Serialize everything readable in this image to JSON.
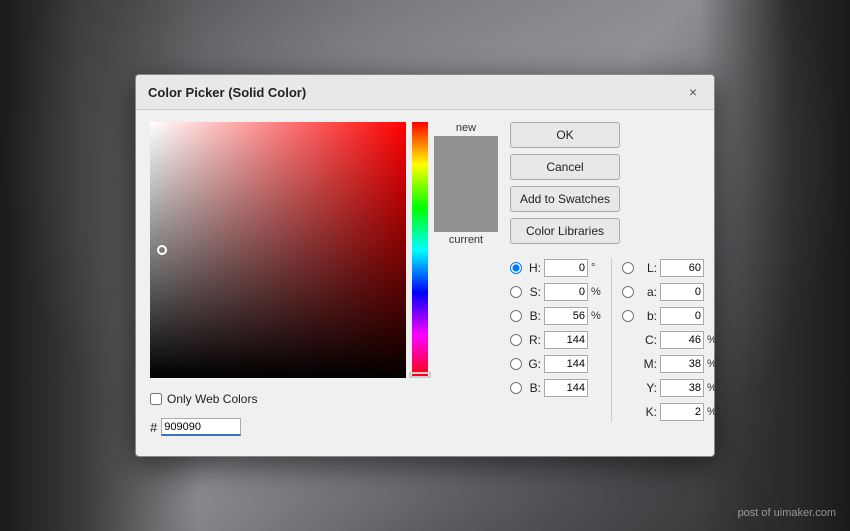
{
  "background": {
    "watermark": "post of uimaker.com"
  },
  "dialog": {
    "title": "Color Picker (Solid Color)",
    "close_icon": "×",
    "buttons": {
      "ok": "OK",
      "cancel": "Cancel",
      "add_to_swatches": "Add to Swatches",
      "color_libraries": "Color Libraries"
    },
    "preview": {
      "new_label": "new",
      "current_label": "current",
      "new_color": "#909090",
      "current_color": "#909090"
    },
    "fields": {
      "H_checked": true,
      "H_value": "0",
      "H_unit": "°",
      "S_value": "0",
      "S_unit": "%",
      "B_value": "56",
      "B_unit": "%",
      "R_value": "144",
      "G_value": "144",
      "B2_value": "144",
      "L_value": "60",
      "a_value": "0",
      "b_value": "0",
      "C_value": "46",
      "C_unit": "%",
      "M_value": "38",
      "M_unit": "%",
      "Y_value": "38",
      "Y_unit": "%",
      "K_value": "2",
      "K_unit": "%",
      "hex_value": "909090"
    },
    "only_web_colors": {
      "checked": false,
      "label": "Only Web Colors"
    }
  }
}
